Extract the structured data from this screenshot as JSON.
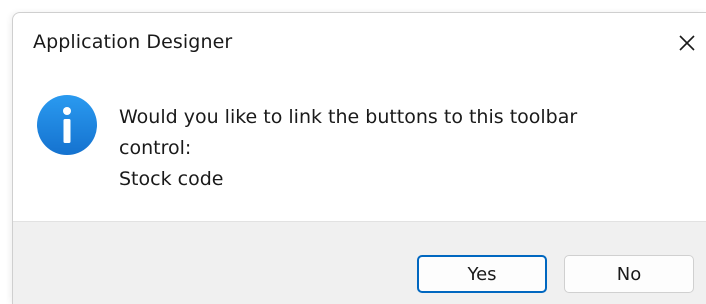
{
  "dialog": {
    "title": "Application Designer",
    "close_icon": "close-icon",
    "info_icon": "info-icon",
    "message_lines": [
      "Would you like to link the buttons to this toolbar",
      "control:",
      "Stock code"
    ],
    "buttons": {
      "yes_label": "Yes",
      "no_label": "No"
    }
  },
  "colors": {
    "info_blue": "#1e88e5",
    "focus_blue": "#0067c0",
    "footer_bg": "#f0f0f0"
  }
}
